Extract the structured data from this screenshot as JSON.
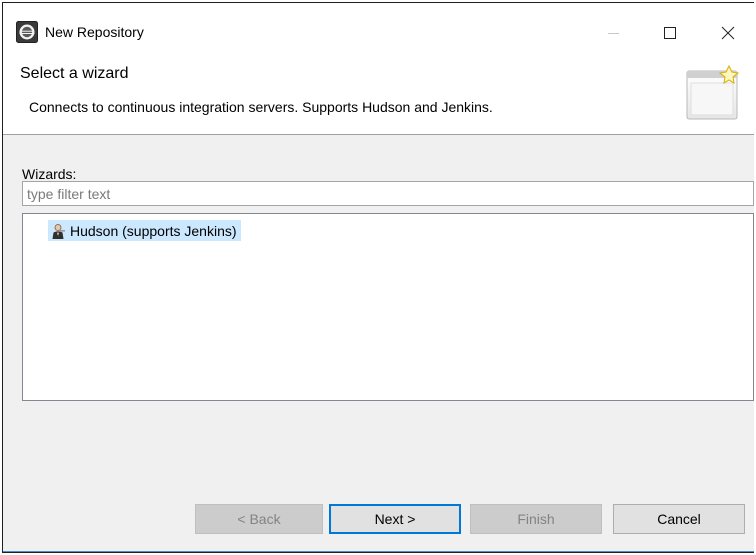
{
  "window": {
    "title": "New Repository"
  },
  "banner": {
    "heading": "Select a wizard",
    "description": "Connects to continuous integration servers. Supports Hudson and Jenkins."
  },
  "wizards": {
    "label": "Wizards:",
    "filter_placeholder": "type filter text",
    "items": [
      {
        "label": "Hudson (supports Jenkins)",
        "icon": "hudson-butler-icon",
        "selected": true
      }
    ]
  },
  "buttons": {
    "back": "< Back",
    "next": "Next >",
    "finish": "Finish",
    "cancel": "Cancel"
  },
  "colors": {
    "selection": "#cce8ff",
    "default_button_border": "#0078d7",
    "disabled_button": "#cccccc"
  }
}
